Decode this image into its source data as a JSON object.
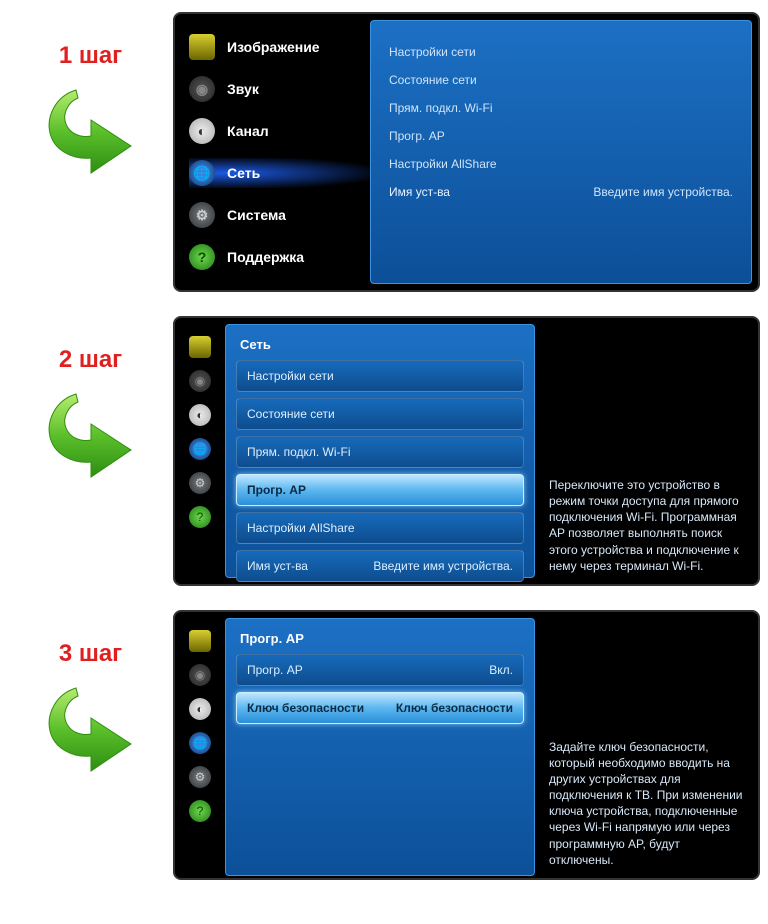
{
  "steps": {
    "s1": "1 шаг",
    "s2": "2 шаг",
    "s3": "3 шаг"
  },
  "menu": {
    "picture": "Изображение",
    "sound": "Звук",
    "channel": "Канал",
    "network": "Сеть",
    "system": "Система",
    "support": "Поддержка"
  },
  "net": {
    "settings": "Настройки сети",
    "status": "Состояние сети",
    "direct": "Прям. подкл. Wi-Fi",
    "softap": "Прогр. AP",
    "allshare": "Настройки AllShare",
    "devname_label": "Имя уст-ва",
    "devname_hint": "Введите имя устройства."
  },
  "softap": {
    "title": "Прогр. AP",
    "row_label": "Прогр. AP",
    "row_value": "Вкл.",
    "key_label": "Ключ безопасности",
    "key_value": "Ключ безопасности"
  },
  "info2": "Переключите это устройство в режим точки доступа для прямого подключения Wi-Fi. Программная AP позволяет выполнять поиск этого устройства и подключение к нему через терминал Wi-Fi.",
  "info3": "Задайте ключ безопасности, который необходимо вводить на других устройствах для подключения к ТВ. При изменении ключа устройства, подключенные через Wi-Fi напрямую или через программную AP, будут отключены."
}
